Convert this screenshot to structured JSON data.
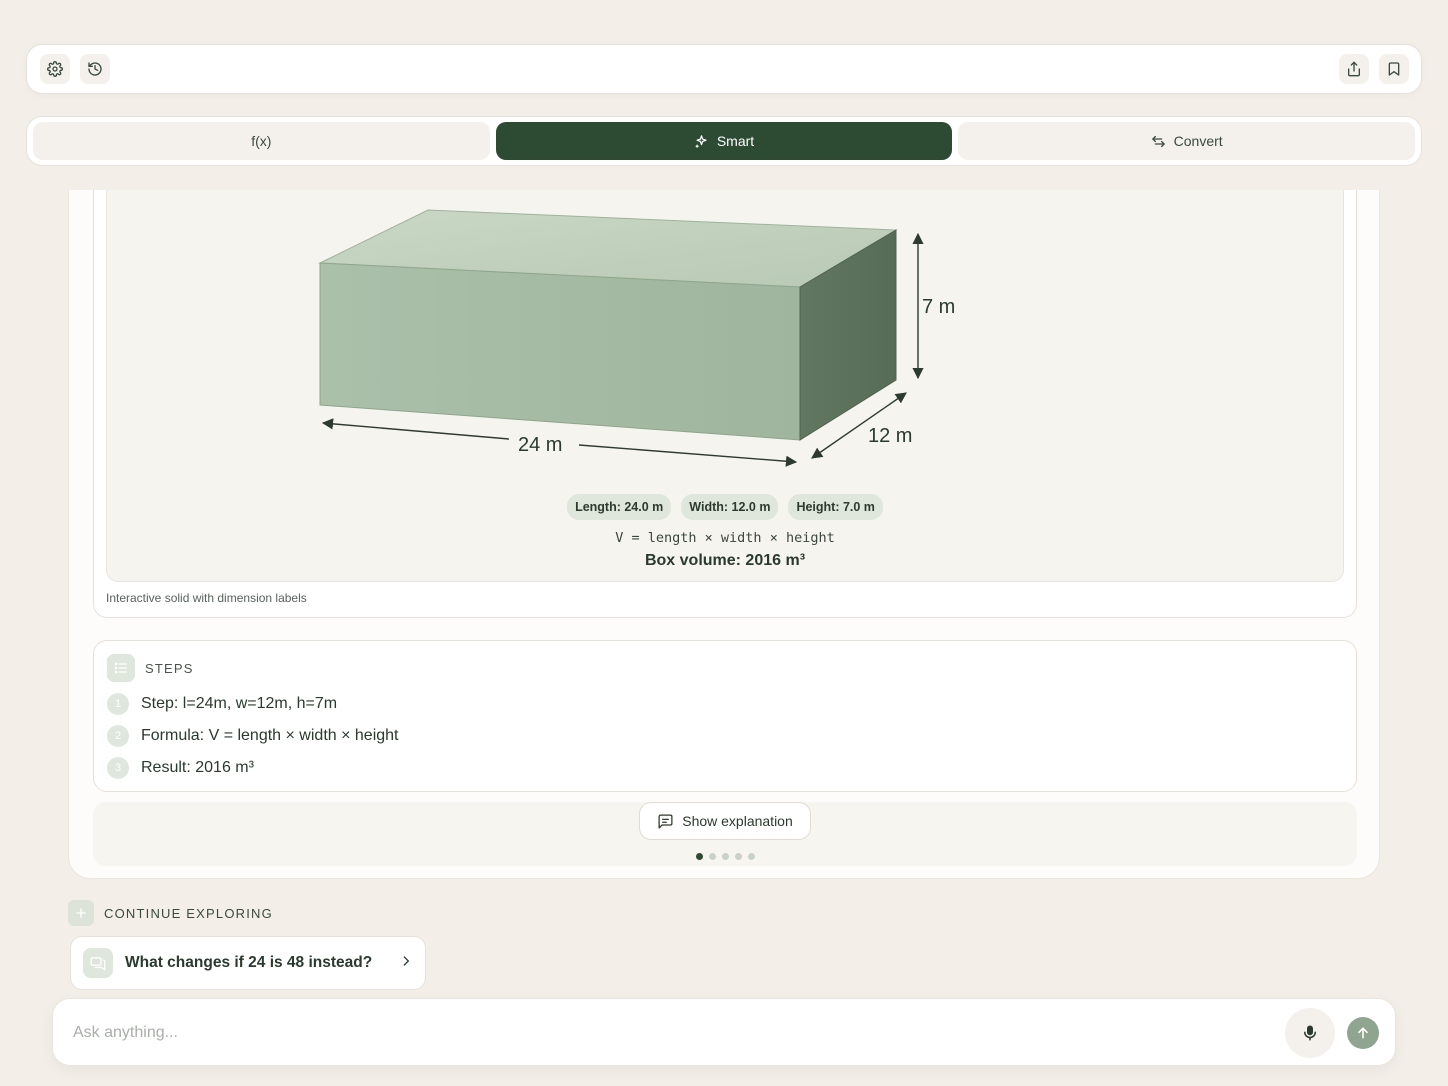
{
  "toolbar": {
    "settings_icon": "gear-icon",
    "history_icon": "history-icon",
    "share_icon": "share-icon",
    "bookmark_icon": "bookmark-icon"
  },
  "modes": {
    "tabs": [
      {
        "label": "f(x)",
        "active": false
      },
      {
        "label": "Smart",
        "active": true,
        "icon": "sparkle-icon"
      },
      {
        "label": "Convert",
        "active": false,
        "icon": "swap-arrows-icon"
      }
    ]
  },
  "visualization": {
    "dimensions": {
      "length": "24 m",
      "width": "12 m",
      "height": "7 m"
    },
    "chips": [
      "Length: 24.0 m",
      "Width: 12.0 m",
      "Height: 7.0 m"
    ],
    "formula": "V = length × width × height",
    "result": "Box volume: 2016 m³",
    "caption": "Interactive solid with dimension labels",
    "colors": {
      "top_face": "#c5d3c1",
      "front_face": "#a9bea8",
      "side_face": "#647862"
    }
  },
  "steps": {
    "title": "STEPS",
    "items": [
      {
        "num": "1",
        "text": "Step: l=24m, w=12m, h=7m"
      },
      {
        "num": "2",
        "text": "Formula: V = length × width × height"
      },
      {
        "num": "3",
        "text": "Result: 2016 m³"
      }
    ]
  },
  "explanation": {
    "button_label": "Show explanation",
    "pager_total": 5,
    "pager_current": 1
  },
  "explore": {
    "title": "CONTINUE EXPLORING",
    "suggestion": "What changes if 24 is 48 instead?"
  },
  "composer": {
    "placeholder": "Ask anything..."
  },
  "theme": {
    "accent": "#2d4a33",
    "background": "#f3efe8"
  }
}
